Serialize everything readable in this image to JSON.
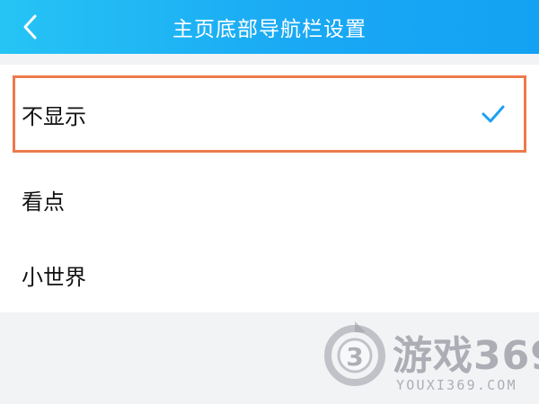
{
  "header": {
    "title": "主页底部导航栏设置",
    "back_icon": "chevron-left-icon"
  },
  "options": [
    {
      "label": "不显示",
      "selected": true
    },
    {
      "label": "看点",
      "selected": false
    },
    {
      "label": "小世界",
      "selected": false
    }
  ],
  "colors": {
    "header_gradient_start": "#26c4f5",
    "header_gradient_end": "#13a1f3",
    "check": "#1aa0f5",
    "highlight_border": "#ec7a4b",
    "background": "#f2f3f5"
  },
  "watermark": {
    "name": "游戏369",
    "url": "YOUXI369.COM"
  }
}
